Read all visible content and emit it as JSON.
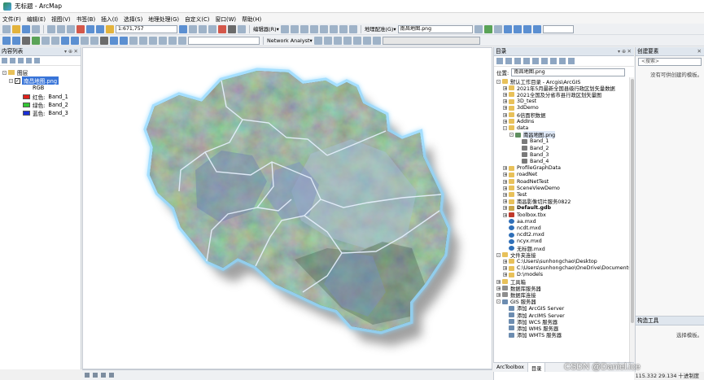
{
  "window": {
    "title": "无标题 - ArcMap"
  },
  "menu": [
    "文件(F)",
    "编辑(E)",
    "视图(V)",
    "书签(B)",
    "插入(I)",
    "选择(S)",
    "地理处理(G)",
    "自定义(C)",
    "窗口(W)",
    "帮助(H)"
  ],
  "toolbar": {
    "scale": "1:671,757",
    "editor": "编辑器(R)▾",
    "georef": "地理配准(G)▾",
    "georef_layer": "南昌地图.png",
    "network_analyst": "Network Analyst▾"
  },
  "toc": {
    "title": "内容列表",
    "layers_label": "图层",
    "layer_name": "南昌地图.png",
    "rgb_label": "RGB",
    "bands": [
      {
        "label": "红色:",
        "band": "Band_1",
        "color": "#e0201b"
      },
      {
        "label": "绿色:",
        "band": "Band_2",
        "color": "#34c734"
      },
      {
        "label": "蓝色:",
        "band": "Band_3",
        "color": "#1a2fd6"
      }
    ]
  },
  "catalog": {
    "title": "目录",
    "location_label": "位置:",
    "location_value": "南昌地图.png",
    "tree": [
      {
        "d": 0,
        "exp": "-",
        "icon": "folder",
        "label": "默认工作目录 - Arcgis\\ArcGIS"
      },
      {
        "d": 1,
        "exp": "+",
        "icon": "folder",
        "label": "2021年5月最新全国县级行政区划矢量数据"
      },
      {
        "d": 1,
        "exp": "+",
        "icon": "folder",
        "label": "2021全国及分省市县行政区划矢量图"
      },
      {
        "d": 1,
        "exp": "+",
        "icon": "folder",
        "label": "3D_test"
      },
      {
        "d": 1,
        "exp": "+",
        "icon": "folder",
        "label": "3dDemo"
      },
      {
        "d": 1,
        "exp": "+",
        "icon": "folder",
        "label": "6倍面积数据"
      },
      {
        "d": 1,
        "exp": "+",
        "icon": "folder",
        "label": "AddIns"
      },
      {
        "d": 1,
        "exp": "-",
        "icon": "folder",
        "label": "data"
      },
      {
        "d": 2,
        "exp": "-",
        "icon": "raster",
        "label": "南昌地图.png"
      },
      {
        "d": 3,
        "exp": "",
        "icon": "band",
        "label": "Band_1"
      },
      {
        "d": 3,
        "exp": "",
        "icon": "band",
        "label": "Band_2"
      },
      {
        "d": 3,
        "exp": "",
        "icon": "band",
        "label": "Band_3"
      },
      {
        "d": 3,
        "exp": "",
        "icon": "band",
        "label": "Band_4"
      },
      {
        "d": 1,
        "exp": "+",
        "icon": "folder",
        "label": "ProfileGraphData"
      },
      {
        "d": 1,
        "exp": "+",
        "icon": "folder",
        "label": "roadNet"
      },
      {
        "d": 1,
        "exp": "+",
        "icon": "folder",
        "label": "RoadNetTest"
      },
      {
        "d": 1,
        "exp": "+",
        "icon": "folder",
        "label": "SceneViewDemo"
      },
      {
        "d": 1,
        "exp": "+",
        "icon": "folder",
        "label": "Test"
      },
      {
        "d": 1,
        "exp": "+",
        "icon": "folder",
        "label": "南昌影像切片服务0822"
      },
      {
        "d": 1,
        "exp": "+",
        "icon": "gdb",
        "label": "Default.gdb"
      },
      {
        "d": 1,
        "exp": "+",
        "icon": "tbx",
        "label": "Toolbox.tbx"
      },
      {
        "d": 1,
        "exp": "",
        "icon": "mxd",
        "label": "aa.mxd"
      },
      {
        "d": 1,
        "exp": "",
        "icon": "mxd",
        "label": "ncdt.mxd"
      },
      {
        "d": 1,
        "exp": "",
        "icon": "mxd",
        "label": "ncdt2.mxd"
      },
      {
        "d": 1,
        "exp": "",
        "icon": "mxd",
        "label": "ncyx.mxd"
      },
      {
        "d": 1,
        "exp": "",
        "icon": "mxd",
        "label": "无标题.mxd"
      },
      {
        "d": 0,
        "exp": "-",
        "icon": "folder",
        "label": "文件夹连接"
      },
      {
        "d": 1,
        "exp": "+",
        "icon": "folder",
        "label": "C:\\Users\\sunhongchao\\Desktop"
      },
      {
        "d": 1,
        "exp": "+",
        "icon": "folder",
        "label": "C:\\Users\\sunhongchao\\OneDrive\\Documents"
      },
      {
        "d": 1,
        "exp": "+",
        "icon": "folder",
        "label": "D:\\models"
      },
      {
        "d": 0,
        "exp": "+",
        "icon": "folder",
        "label": "工具箱"
      },
      {
        "d": 0,
        "exp": "+",
        "icon": "db",
        "label": "数据库服务器"
      },
      {
        "d": 0,
        "exp": "+",
        "icon": "db",
        "label": "数据库连接"
      },
      {
        "d": 0,
        "exp": "-",
        "icon": "server",
        "label": "GIS 服务器"
      },
      {
        "d": 1,
        "exp": "",
        "icon": "server",
        "label": "添加 ArcGIS Server"
      },
      {
        "d": 1,
        "exp": "",
        "icon": "server",
        "label": "添加 ArcIMS Server"
      },
      {
        "d": 1,
        "exp": "",
        "icon": "server",
        "label": "添加 WCS 服务器"
      },
      {
        "d": 1,
        "exp": "",
        "icon": "server",
        "label": "添加 WMS 服务器"
      },
      {
        "d": 1,
        "exp": "",
        "icon": "server",
        "label": "添加 WMTS 服务器"
      }
    ],
    "tabs": [
      "ArcToolbox",
      "目录"
    ]
  },
  "create_features": {
    "title": "创建要素",
    "search": "<搜索>",
    "message": "没有可供创建的模板。"
  },
  "construct_tools": {
    "title": "构造工具",
    "message": "选择模板。"
  },
  "status": {
    "coords": "115.332  29.134 十进制度"
  },
  "watermark": "CSDN @Daniel.ice"
}
